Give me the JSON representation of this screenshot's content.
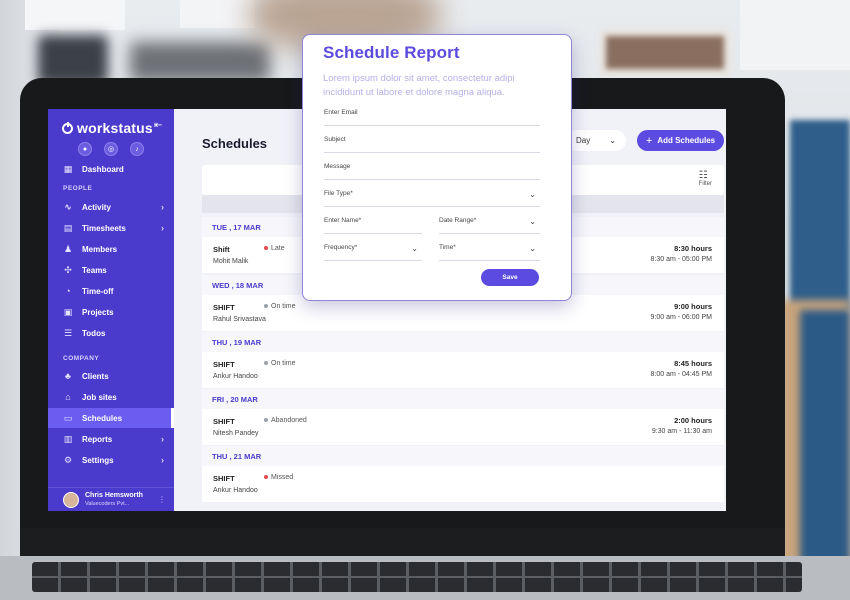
{
  "app": {
    "logo": "workstatus",
    "page_title": "Schedules"
  },
  "sidebar": {
    "sections": {
      "people": "PEOPLE",
      "company": "COMPANY"
    },
    "items": [
      {
        "label": "Dashboard",
        "icon": "dashboard-icon"
      },
      {
        "label": "Activity",
        "icon": "activity-icon",
        "chevron": true
      },
      {
        "label": "Timesheets",
        "icon": "timesheets-icon",
        "chevron": true
      },
      {
        "label": "Members",
        "icon": "members-icon"
      },
      {
        "label": "Teams",
        "icon": "teams-icon"
      },
      {
        "label": "Time-off",
        "icon": "time-off-icon"
      },
      {
        "label": "Projects",
        "icon": "projects-icon"
      },
      {
        "label": "Todos",
        "icon": "todos-icon"
      },
      {
        "label": "Clients",
        "icon": "clients-icon"
      },
      {
        "label": "Job sites",
        "icon": "job-sites-icon"
      },
      {
        "label": "Schedules",
        "icon": "schedules-icon",
        "active": true
      },
      {
        "label": "Reports",
        "icon": "reports-icon",
        "chevron": true
      },
      {
        "label": "Settings",
        "icon": "settings-icon",
        "chevron": true
      }
    ],
    "user": {
      "name": "Chris Hemsworth",
      "org": "Valuecoders Pvt..."
    }
  },
  "toolbar": {
    "day_select": "Day",
    "add_button": "Add Schedules",
    "filter": "Filter"
  },
  "schedule": [
    {
      "date": "TUE , 17 MAR",
      "label": "Shift",
      "name": "Mohit Malik",
      "status": "Late",
      "status_color": "#e5484d",
      "hours": "8:30 hours",
      "range": "8:30 am - 05:00 PM"
    },
    {
      "date": "WED , 18 MAR",
      "label": "SHIFT",
      "name": "Rahul Srivastava",
      "status": "On time",
      "status_color": "#9aa0a6",
      "hours": "9:00 hours",
      "range": "9:00 am - 06:00 PM"
    },
    {
      "date": "THU , 19 MAR",
      "label": "SHIFT",
      "name": "Ankur Handoo",
      "status": "On time",
      "status_color": "#9aa0a6",
      "hours": "8:45 hours",
      "range": "8:00 am - 04:45 PM"
    },
    {
      "date": "FRI , 20 MAR",
      "label": "SHIFT",
      "name": "Nitesh Pandey",
      "status": "Abandoned",
      "status_color": "#9aa0a6",
      "hours": "2:00 hours",
      "range": "9:30 am - 11:30 am"
    },
    {
      "date": "THU , 21 MAR",
      "label": "SHIFT",
      "name": "Ankur Handoo",
      "status": "Missed",
      "status_color": "#e5484d",
      "hours": "",
      "range": ""
    }
  ],
  "modal": {
    "title": "Schedule Report",
    "subtitle": "Lorem ipsum dolor sit amet, consectetur adipi incididunt ut labore et dolore magna aliqua.",
    "fields": {
      "email": "Enter Email",
      "subject": "Subject",
      "message": "Message",
      "file_type": "File Type*",
      "name": "Enter Name*",
      "date_range": "Date Range*",
      "frequency": "Frequency*",
      "time": "Time*"
    },
    "save": "Save"
  },
  "colors": {
    "brand": "#4b3bcc",
    "accent": "#5b4be0",
    "late": "#e5484d"
  }
}
